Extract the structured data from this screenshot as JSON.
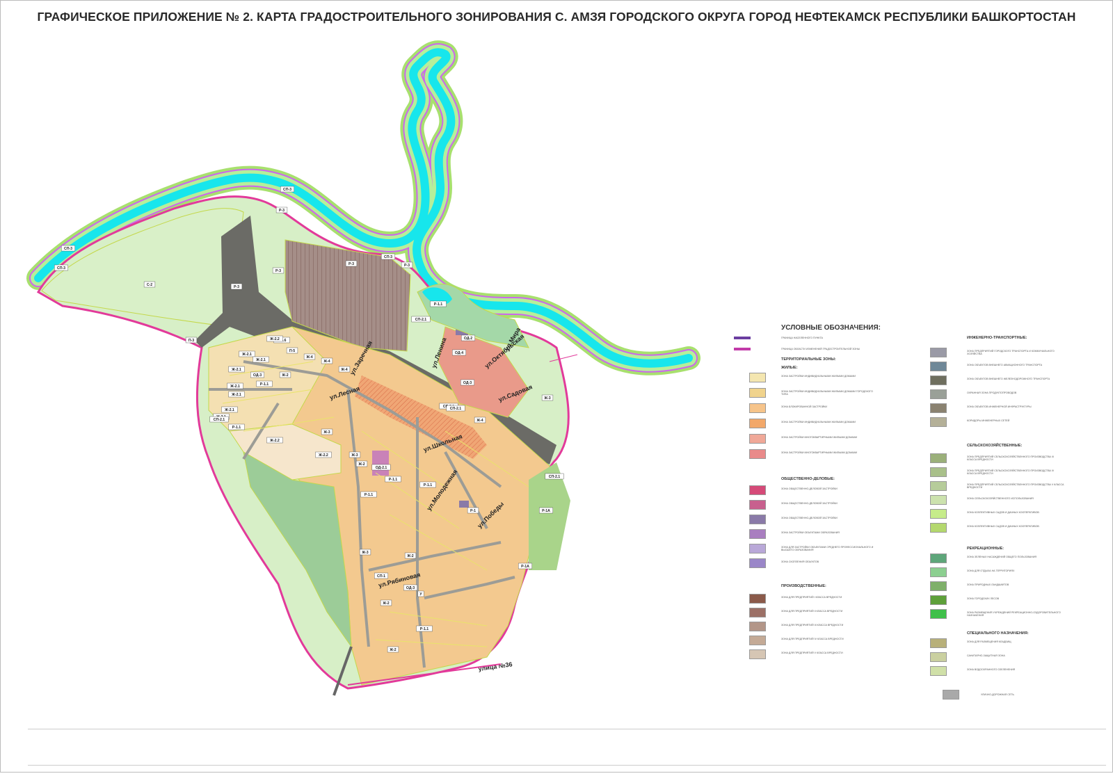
{
  "title": "ГРАФИЧЕСКОЕ ПРИЛОЖЕНИЕ № 2. КАРТА ГРАДОСТРОИТЕЛЬНОГО ЗОНИРОВАНИЯ С. АМЗЯ ГОРОДСКОГО ОКРУГА ГОРОД НЕФТЕКАМСК РЕСПУБЛИКИ БАШКОРТОСТАН",
  "map": {
    "zone_labels": [
      "СП-3",
      "Р-3",
      "СП-3",
      "СП-3",
      "С-2",
      "Р-3",
      "Р-3",
      "СП-3",
      "Р-3",
      "Р-3",
      "П-3",
      "Р-1.1",
      "СП-2.1",
      "И-5.6",
      "П-5",
      "Ж-2.2",
      "Ж-2.1",
      "Ж-2.1",
      "Ж-2.1",
      "Ж-2.1",
      "ОД-3",
      "Р-1.1",
      "Ж-2.1",
      "Ж-2.1",
      "Ж-2.1",
      "СП-2.1",
      "Р-1.1",
      "Ж-2",
      "Ж-3",
      "Ж-4",
      "Ж-4",
      "Ж-4",
      "Ж-2.2",
      "Ж-2.2",
      "Р-1.1",
      "СП-2.1",
      "Ж-3",
      "Ж-2",
      "ОД-2.1",
      "Р-1.1",
      "Ж-3",
      "Ж-2",
      "Ж-2",
      "Р-1.1",
      "СП-1",
      "ОД-3",
      "У",
      "Ж-2",
      "Р-1А",
      "Р-1А",
      "Р-1",
      "СП-2.1",
      "Ж-3",
      "ОД-3",
      "ОД-4",
      "Ж-4",
      "СП-2.1",
      "Р-1.1",
      "ОД-2"
    ],
    "street_labels": [
      "ул.Лесная",
      "ул.Заречная",
      "ул.Ленина",
      "ул.Садовая",
      "ул.Школьная",
      "ул.Молодежная",
      "ул.Победы",
      "ул.Рябиновая",
      "улица №36",
      "ул.Октябрьская",
      "ул.Мира"
    ]
  },
  "legend": {
    "heading": "УСЛОВНЫЕ ОБОЗНАЧЕНИЯ:",
    "border_items": [
      "ГРАНИЦА НАСЕЛЕННОГО ПУНКТА",
      "ГРАНИЦА ОБЛАСТИ ИЗМЕНЕНИЙ ГРАДОСТРОИТЕЛЬНОЙ ЗОНЫ"
    ],
    "sections": {
      "territorial": "ТЕРРИТОРИАЛЬНЫЕ ЗОНЫ:",
      "residential": "ЖИЛЫЕ:",
      "public": "ОБЩЕСТВЕННО-ДЕЛОВЫЕ:",
      "industrial": "ПРОИЗВОДСТВЕННЫЕ:",
      "engineering": "ИНЖЕНЕРНО-ТРАНСПОРТНЫЕ:",
      "agricultural": "СЕЛЬСКОХОЗЯЙСТВЕННЫЕ:",
      "recreational": "РЕКРЕАЦИОННЫЕ:",
      "special": "СПЕЦИАЛЬНОГО НАЗНАЧЕНИЯ:"
    },
    "residential_items": [
      "ЗОНА ЗАСТРОЙКИ ИНДИВИДУАЛЬНЫМИ ЖИЛЫМИ ДОМАМИ",
      "ЗОНА ЗАСТРОЙКИ ИНДИВИДУАЛЬНЫМИ ЖИЛЫМИ ДОМАМИ ГОРОДСКОГО ТИПА",
      "ЗОНА БЛОКИРОВАННОЙ ЗАСТРОЙКИ",
      "ЗОНА ЗАСТРОЙКИ ИНДИВИДУАЛЬНЫМИ ЖИЛЫМИ ДОМАМИ",
      "ЗОНА ЗАСТРОЙКИ МНОГОКВАРТИРНЫМИ ЖИЛЫМИ ДОМАМИ",
      "ЗОНА ЗАСТРОЙКИ МНОГОКВАРТИРНЫМИ ЖИЛЫМИ ДОМАМИ"
    ],
    "public_items": [
      "ЗОНА ОБЩЕСТВЕННО-ДЕЛОВОЙ ЗАСТРОЙКИ",
      "ЗОНА ОБЩЕСТВЕННО-ДЕЛОВОЙ ЗАСТРОЙКИ",
      "ЗОНА ОБЩЕСТВЕННО-ДЕЛОВОЙ ЗАСТРОЙКИ",
      "ЗОНА ЗАСТРОЙКИ ОБЪЕКТАМИ ОБРАЗОВАНИЯ",
      "ЗОНА ДЛЯ ЗАСТРОЙКИ ОБЪЕКТАМИ СРЕДНЕГО ПРОФЕССИОНАЛЬНОГО И ВЫСШЕГО ОБРАЗОВАНИЯ",
      "ЗОНА СКОПЛЕНИЯ ОБЪЕКТОВ"
    ],
    "industrial_items": [
      "ЗОНА ДЛЯ ПРЕДПРИЯТИЙ I КЛАССА ВРЕДНОСТИ",
      "ЗОНА ДЛЯ ПРЕДПРИЯТИЙ II КЛАССА ВРЕДНОСТИ",
      "ЗОНА ДЛЯ ПРЕДПРИЯТИЙ III КЛАССА ВРЕДНОСТИ",
      "ЗОНА ДЛЯ ПРЕДПРИЯТИЙ IV КЛАССА ВРЕДНОСТИ",
      "ЗОНА ДЛЯ ПРЕДПРИЯТИЙ V КЛАССА ВРЕДНОСТИ"
    ],
    "engineering_items": [
      "ЗОНА ПРЕДПРИЯТИЙ ГОРОДСКОГО ТРАНСПОРТА И КОММУНАЛЬНОГО ХОЗЯЙСТВА",
      "ЗОНА ОБЪЕКТОВ ВНЕШНЕГО АВИАЦИОННОГО ТРАНСПОРТА",
      "ЗОНА ОБЪЕКТОВ ВНЕШНЕГО ЖЕЛЕЗНОДОРОЖНОГО ТРАНСПОРТА",
      "ОХРАННАЯ ЗОНА ПРОДУКТОПРОВОДОВ",
      "ЗОНА ОБЪЕКТОВ ИНЖЕНЕРНОЙ ИНФРАСТРУКТУРЫ",
      "КОРИДОРЫ ИНЖЕНЕРНЫХ СЕТЕЙ"
    ],
    "agricultural_items": [
      "ЗОНА ПРЕДПРИЯТИЙ СЕЛЬСКОХОЗЯЙСТВЕННОГО ПРОИЗВОДСТВА III КЛАССА ВРЕДНОСТИ",
      "ЗОНА ПРЕДПРИЯТИЙ СЕЛЬСКОХОЗЯЙСТВЕННОГО ПРОИЗВОДСТВА IV КЛАССА ВРЕДНОСТИ",
      "ЗОНА ПРЕДПРИЯТИЙ СЕЛЬСКОХОЗЯЙСТВЕННОГО ПРОИЗВОДСТВА V КЛАССА ВРЕДНОСТИ",
      "ЗОНА СЕЛЬСКОХОЗЯЙСТВЕННОГО ИСПОЛЬЗОВАНИЯ",
      "ЗОНА КОЛЛЕКТИВНЫХ САДОВ И ДАЧНЫХ КООПЕРАТИВОВ",
      "ЗОНА КОЛЛЕКТИВНЫХ САДОВ И ДАЧНЫХ КООПЕРАТИВОВ"
    ],
    "recreational_items": [
      "ЗОНА ЗЕЛЕНЫХ НАСАЖДЕНИЙ ОБЩЕГО ПОЛЬЗОВАНИЯ",
      "ЗОНА ДЛЯ ОТДЫХА НА ТЕРРИТОРИЯХ",
      "ЗОНА ПРИРОДНЫХ ЛАНДШАФТОВ",
      "ЗОНА ГОРОДСКИХ ЛЕСОВ",
      "ЗОНА РАЗМЕЩЕНИЯ УЧРЕЖДЕНИЙ РЕКРЕАЦИОННО-ОЗДОРОВИТЕЛЬНОГО НАЗНАЧЕНИЯ"
    ],
    "special_items": [
      "ЗОНА ДЛЯ РАЗМЕЩЕНИЯ КЛАДБИЩ",
      "САНИТАРНО-ЗАЩИТНАЯ ЗОНА",
      "ЗОНА ВОДООХРАННОГО ОЗЕЛЕНЕНИЯ"
    ],
    "road_item": "УЛИЧНО-ДОРОЖНАЯ СЕТЬ",
    "colors": {
      "residential": [
        "#f4e6b0",
        "#f0d38c",
        "#f6c48a",
        "#f2a86a",
        "#f0a898",
        "#e98a8a"
      ],
      "public": [
        "#d54a78",
        "#c8608e",
        "#8a7aa8",
        "#a97ec0",
        "#b9a8d8",
        "#9a86c8"
      ],
      "industrial": [
        "#8b5a4a",
        "#9c7066",
        "#b39688",
        "#c4aa96",
        "#d6c6b4"
      ],
      "engineering": [
        "#9a9aa6",
        "#6f8898",
        "#6f6f5f",
        "#9aa098",
        "#8a8270",
        "#b4b098"
      ],
      "agricultural": [
        "#9bb07a",
        "#a9c08a",
        "#b6cc9a",
        "#cce2ae",
        "#c6ec8a",
        "#b4d86e"
      ],
      "recreational": [
        "#5ea67a",
        "#8ccf90",
        "#7fb06a",
        "#5ea03a",
        "#3fc04a"
      ],
      "special": [
        "#b8b07a",
        "#cad0a0",
        "#d0e0a8"
      ]
    }
  }
}
